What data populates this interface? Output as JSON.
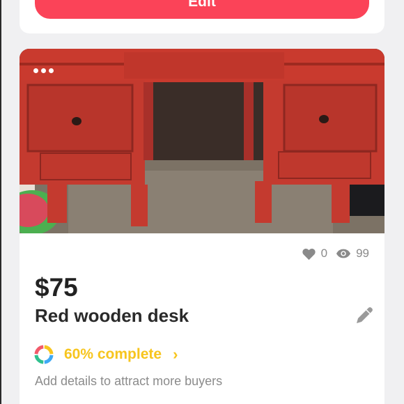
{
  "edit_button": {
    "label": "Edit"
  },
  "listing": {
    "likes": "0",
    "views": "99",
    "price": "$75",
    "title": "Red wooden desk",
    "progress": {
      "percent": 60,
      "text": "60% complete",
      "segment_colors": [
        "#f7c51e",
        "#3da9f5",
        "#2fc08e",
        "#f25a6a"
      ]
    },
    "hint": "Add details to attract more buyers"
  },
  "colors": {
    "accent": "#fb4358",
    "progress_yellow": "#f7c51e",
    "muted": "#8a8a8a"
  },
  "icons": {
    "more": "more-dots-icon",
    "like": "heart-icon",
    "views": "eye-icon",
    "edit": "pencil-icon",
    "progress": "progress-ring-icon",
    "chevron": "chevron-right-icon"
  }
}
